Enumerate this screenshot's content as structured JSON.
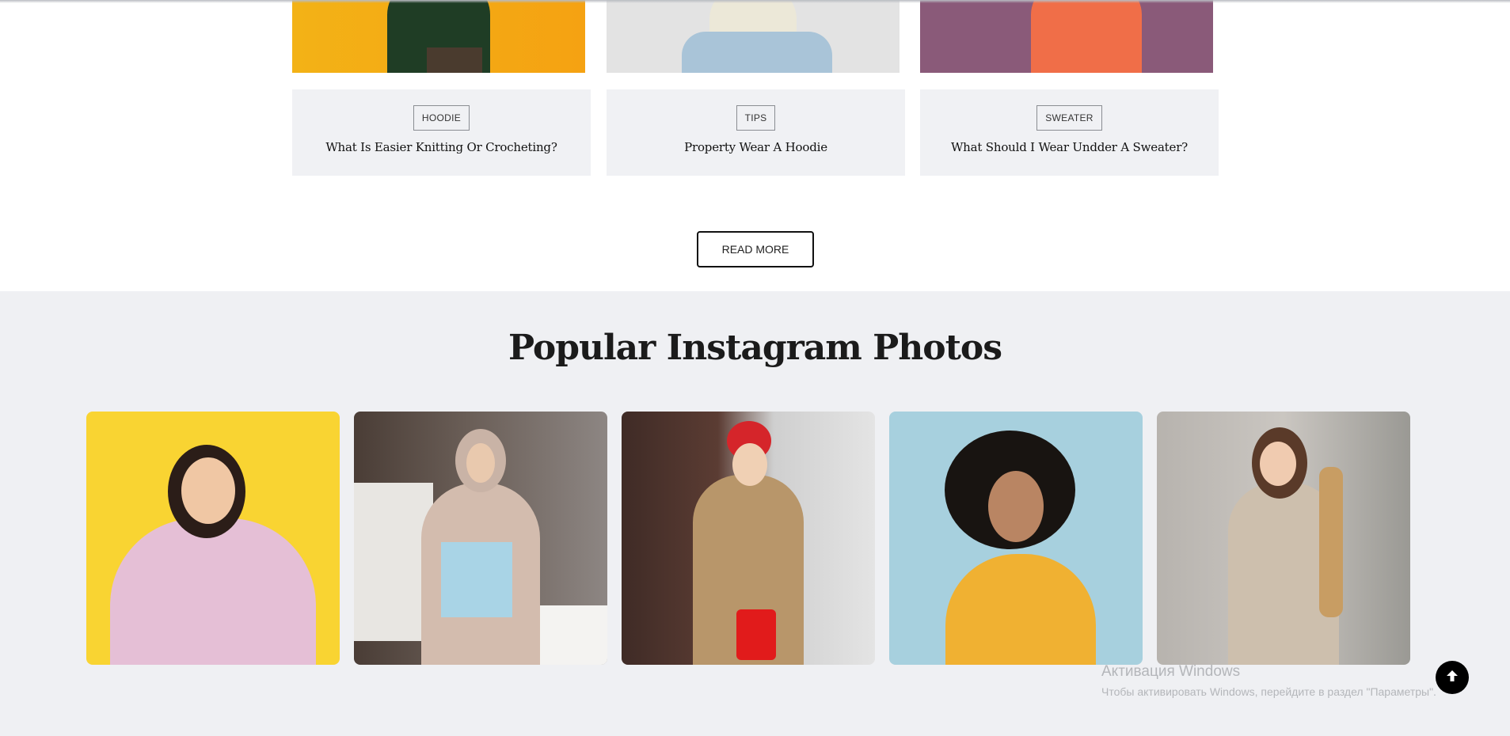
{
  "blog": {
    "posts": [
      {
        "tag": "HOODIE",
        "title": "What Is Easier Knitting Or Crocheting?"
      },
      {
        "tag": "TIPS",
        "title": "Property Wear A Hoodie"
      },
      {
        "tag": "SWEATER",
        "title": "What Should I Wear Undder A Sweater?"
      }
    ],
    "read_more": "READ MORE"
  },
  "instagram": {
    "title": "Popular Instagram Photos",
    "photos": [
      {
        "alt": "woman-with-headphones"
      },
      {
        "alt": "woman-in-hijab"
      },
      {
        "alt": "woman-in-red-beret"
      },
      {
        "alt": "woman-with-curly-hair"
      },
      {
        "alt": "woman-with-bread"
      }
    ]
  },
  "windows_activation": {
    "title": "Активация Windows",
    "message": "Чтобы активировать Windows, перейдите в раздел \"Параметры\"."
  },
  "icons": {
    "scroll_top": "arrow-up-icon"
  }
}
